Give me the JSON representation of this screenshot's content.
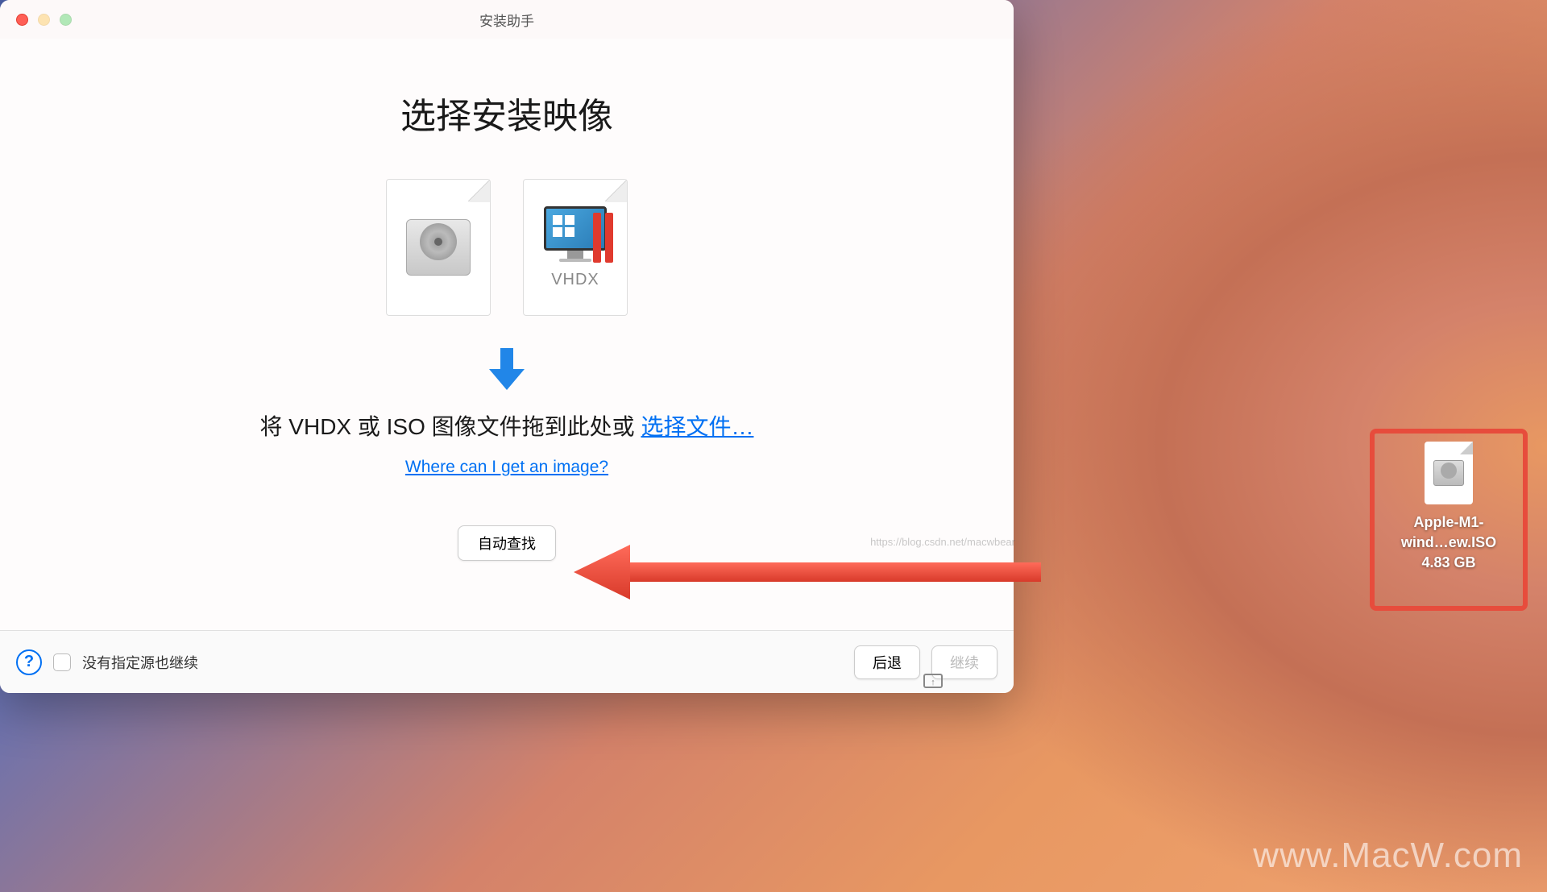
{
  "window": {
    "title": "安装助手",
    "heading": "选择安装映像",
    "vhdx_label": "VHDX",
    "instruction_prefix": "将 VHDX 或 ISO 图像文件拖到此处或 ",
    "instruction_link": "选择文件…",
    "sublink": "Where can I get an image?",
    "auto_find": "自动查找"
  },
  "footer": {
    "checkbox_label": "没有指定源也继续",
    "back": "后退",
    "continue": "继续"
  },
  "desktop_file": {
    "line1": "Apple-M1-",
    "line2": "wind…ew.ISO",
    "size": "4.83 GB"
  },
  "watermarks": {
    "csdn": "https://blog.csdn.net/macwbear",
    "macw": "www.MacW.com"
  }
}
